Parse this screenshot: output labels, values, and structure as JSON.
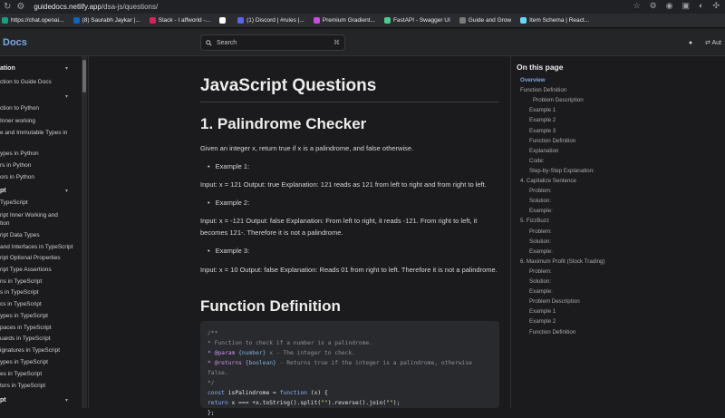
{
  "browser": {
    "url_host": "guidedocs.netlify.app",
    "url_path": "/dsa-js/questions/",
    "bookmarks": [
      {
        "label": "https://chat.openai...",
        "color": "#10a37f"
      },
      {
        "label": "(8) Saurabh Jaykar |...",
        "color": "#0a66c2"
      },
      {
        "label": "Slack - I affworld -...",
        "color": "#e01e5a"
      },
      {
        "label": "",
        "color": "#ffffff"
      },
      {
        "label": "(1) Discord | #rules |...",
        "color": "#5865f2"
      },
      {
        "label": "Premium Gradient...",
        "color": "#c94ce0"
      },
      {
        "label": "FastAPI - Swagger UI",
        "color": "#49cc90"
      },
      {
        "label": "Guide and Grow",
        "color": "#7a7a7a"
      },
      {
        "label": "Item Schema | React...",
        "color": "#61dafb"
      }
    ]
  },
  "navbar": {
    "brand": "Docs",
    "search_placeholder": "Search",
    "right_label": "Aut"
  },
  "sidebar": {
    "items": [
      {
        "label": "ation",
        "type": "cat",
        "caret": "▾"
      },
      {
        "label": "ction to Guide Docs",
        "type": "item"
      },
      {
        "label": "",
        "type": "cat",
        "caret": "▾"
      },
      {
        "label": "ction to Python",
        "type": "item"
      },
      {
        "label": "Inner working",
        "type": "item"
      },
      {
        "label": "e and Immutable Types in",
        "type": "item"
      },
      {
        "label": "",
        "type": "item"
      },
      {
        "label": "ypes in Python",
        "type": "item"
      },
      {
        "label": "rs in Python",
        "type": "item"
      },
      {
        "label": "ors in Python",
        "type": "item"
      },
      {
        "label": "pt",
        "type": "cat",
        "caret": "▾"
      },
      {
        "label": "TypeScript",
        "type": "item"
      },
      {
        "label": "ript Inner Working and",
        "type": "item"
      },
      {
        "label": "tion",
        "type": "item"
      },
      {
        "label": "ript Data Types",
        "type": "item"
      },
      {
        "label": "and Interfaces in TypeScript",
        "type": "item"
      },
      {
        "label": "ript Optional Properties",
        "type": "item"
      },
      {
        "label": "ript Type Assertions",
        "type": "item"
      },
      {
        "label": "ns in TypeScript",
        "type": "item"
      },
      {
        "label": "s in TypeScript",
        "type": "item"
      },
      {
        "label": "cs in TypeScript",
        "type": "item"
      },
      {
        "label": "ypes in TypeScript",
        "type": "item"
      },
      {
        "label": "paces in TypeScript",
        "type": "item"
      },
      {
        "label": "uards in TypeScript",
        "type": "item"
      },
      {
        "label": "ignatures in TypeScript",
        "type": "item"
      },
      {
        "label": "ypes in TypeScript",
        "type": "item"
      },
      {
        "label": "es in TypeScript",
        "type": "item"
      },
      {
        "label": "tors in TypeScript",
        "type": "item"
      },
      {
        "label": "pt",
        "type": "cat",
        "caret": "▾"
      }
    ]
  },
  "main": {
    "title": "JavaScript Questions",
    "section1": "1. Palindrome Checker",
    "intro": "Given an integer x, return true if x is a palindrome, and false otherwise.",
    "example1_label": "Example 1:",
    "example1_text": "Input: x = 121 Output: true Explanation: 121 reads as 121 from left to right and from right to left.",
    "example2_label": "Example 2:",
    "example2_text": "Input: x = -121 Output: false Explanation: From left to right, it reads -121. From right to left, it becomes 121-. Therefore it is not a palindrome.",
    "example3_label": "Example 3:",
    "example3_text": "Input: x = 10 Output: false Explanation: Reads 01 from right to left. Therefore it is not a palindrome.",
    "section2": "Function Definition",
    "code": {
      "l1": "/**",
      "l2": " * Function to check if a number is a palindrome.",
      "l3_tag": " * @param",
      "l3_type": " {number}",
      "l3_rest": " x - The integer to check.",
      "l4_tag": " * @returns",
      "l4_type": " {boolean}",
      "l4_rest": " - Returns true if the integer is a palindrome, otherwise false.",
      "l5": " */",
      "l6_kw": "const",
      "l6_rest": " isPalindrome = ",
      "l6_kw2": "function",
      "l6_end": " (x) {",
      "l7_kw": "  return",
      "l7_rest": " x === +x.toString().split(",
      "l7_str1": "\"\"",
      "l7_mid": ").reverse().join(",
      "l7_str2": "\"\"",
      "l7_end": ");",
      "l8": "};"
    }
  },
  "toc": {
    "title": "On this page",
    "items": [
      {
        "label": "Overview",
        "level": 0,
        "active": true
      },
      {
        "label": "Function Definition",
        "level": 0
      },
      {
        "label": "Problem Description",
        "level": 2
      },
      {
        "label": "Example 1",
        "level": 1
      },
      {
        "label": "Example 2",
        "level": 1
      },
      {
        "label": "Example 3",
        "level": 1
      },
      {
        "label": "Function Definition",
        "level": 1
      },
      {
        "label": "Explanation",
        "level": 1
      },
      {
        "label": "Code:",
        "level": 1
      },
      {
        "label": "Step-by-Step Explanation:",
        "level": 1
      },
      {
        "label": "4. Capitalize Sentence",
        "level": 0
      },
      {
        "label": "Problem:",
        "level": 1
      },
      {
        "label": "Solution:",
        "level": 1
      },
      {
        "label": "Example:",
        "level": 1
      },
      {
        "label": "5. FizzBuzz",
        "level": 0
      },
      {
        "label": "Problem:",
        "level": 1
      },
      {
        "label": "Solution:",
        "level": 1
      },
      {
        "label": "Example:",
        "level": 1
      },
      {
        "label": "6. Maximum Profit (Stock Trading)",
        "level": 0
      },
      {
        "label": "Problem:",
        "level": 1
      },
      {
        "label": "Solution:",
        "level": 1
      },
      {
        "label": "Example:",
        "level": 1
      },
      {
        "label": "Problem Description",
        "level": 1
      },
      {
        "label": "Example 1",
        "level": 1
      },
      {
        "label": "Example 2",
        "level": 1
      },
      {
        "label": "Function Definition",
        "level": 1
      }
    ]
  }
}
